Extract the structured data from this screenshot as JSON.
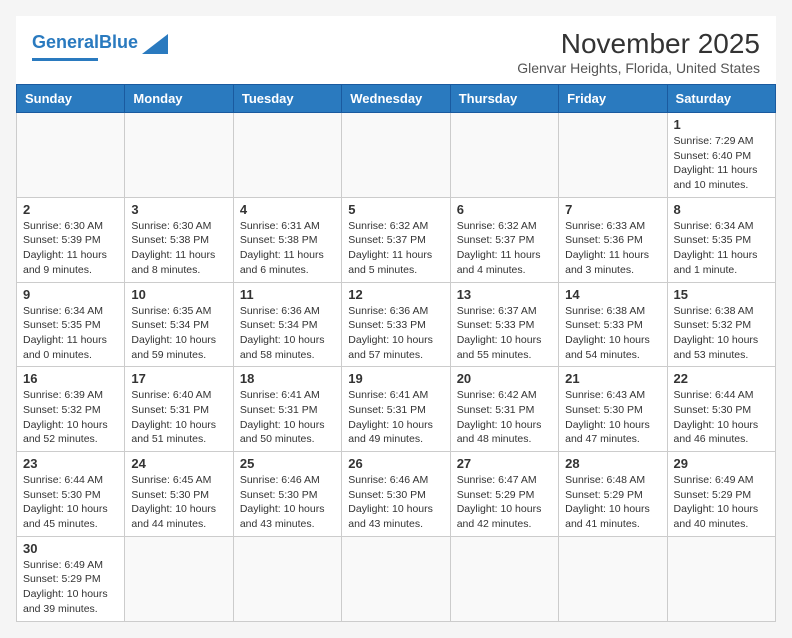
{
  "header": {
    "logo_general": "General",
    "logo_blue": "Blue",
    "month_title": "November 2025",
    "location": "Glenvar Heights, Florida, United States"
  },
  "days_of_week": [
    "Sunday",
    "Monday",
    "Tuesday",
    "Wednesday",
    "Thursday",
    "Friday",
    "Saturday"
  ],
  "weeks": [
    [
      {
        "day": "",
        "info": ""
      },
      {
        "day": "",
        "info": ""
      },
      {
        "day": "",
        "info": ""
      },
      {
        "day": "",
        "info": ""
      },
      {
        "day": "",
        "info": ""
      },
      {
        "day": "",
        "info": ""
      },
      {
        "day": "1",
        "info": "Sunrise: 7:29 AM\nSunset: 6:40 PM\nDaylight: 11 hours and 10 minutes."
      }
    ],
    [
      {
        "day": "2",
        "info": "Sunrise: 6:30 AM\nSunset: 5:39 PM\nDaylight: 11 hours and 9 minutes."
      },
      {
        "day": "3",
        "info": "Sunrise: 6:30 AM\nSunset: 5:38 PM\nDaylight: 11 hours and 8 minutes."
      },
      {
        "day": "4",
        "info": "Sunrise: 6:31 AM\nSunset: 5:38 PM\nDaylight: 11 hours and 6 minutes."
      },
      {
        "day": "5",
        "info": "Sunrise: 6:32 AM\nSunset: 5:37 PM\nDaylight: 11 hours and 5 minutes."
      },
      {
        "day": "6",
        "info": "Sunrise: 6:32 AM\nSunset: 5:37 PM\nDaylight: 11 hours and 4 minutes."
      },
      {
        "day": "7",
        "info": "Sunrise: 6:33 AM\nSunset: 5:36 PM\nDaylight: 11 hours and 3 minutes."
      },
      {
        "day": "8",
        "info": "Sunrise: 6:34 AM\nSunset: 5:35 PM\nDaylight: 11 hours and 1 minute."
      }
    ],
    [
      {
        "day": "9",
        "info": "Sunrise: 6:34 AM\nSunset: 5:35 PM\nDaylight: 11 hours and 0 minutes."
      },
      {
        "day": "10",
        "info": "Sunrise: 6:35 AM\nSunset: 5:34 PM\nDaylight: 10 hours and 59 minutes."
      },
      {
        "day": "11",
        "info": "Sunrise: 6:36 AM\nSunset: 5:34 PM\nDaylight: 10 hours and 58 minutes."
      },
      {
        "day": "12",
        "info": "Sunrise: 6:36 AM\nSunset: 5:33 PM\nDaylight: 10 hours and 57 minutes."
      },
      {
        "day": "13",
        "info": "Sunrise: 6:37 AM\nSunset: 5:33 PM\nDaylight: 10 hours and 55 minutes."
      },
      {
        "day": "14",
        "info": "Sunrise: 6:38 AM\nSunset: 5:33 PM\nDaylight: 10 hours and 54 minutes."
      },
      {
        "day": "15",
        "info": "Sunrise: 6:38 AM\nSunset: 5:32 PM\nDaylight: 10 hours and 53 minutes."
      }
    ],
    [
      {
        "day": "16",
        "info": "Sunrise: 6:39 AM\nSunset: 5:32 PM\nDaylight: 10 hours and 52 minutes."
      },
      {
        "day": "17",
        "info": "Sunrise: 6:40 AM\nSunset: 5:31 PM\nDaylight: 10 hours and 51 minutes."
      },
      {
        "day": "18",
        "info": "Sunrise: 6:41 AM\nSunset: 5:31 PM\nDaylight: 10 hours and 50 minutes."
      },
      {
        "day": "19",
        "info": "Sunrise: 6:41 AM\nSunset: 5:31 PM\nDaylight: 10 hours and 49 minutes."
      },
      {
        "day": "20",
        "info": "Sunrise: 6:42 AM\nSunset: 5:31 PM\nDaylight: 10 hours and 48 minutes."
      },
      {
        "day": "21",
        "info": "Sunrise: 6:43 AM\nSunset: 5:30 PM\nDaylight: 10 hours and 47 minutes."
      },
      {
        "day": "22",
        "info": "Sunrise: 6:44 AM\nSunset: 5:30 PM\nDaylight: 10 hours and 46 minutes."
      }
    ],
    [
      {
        "day": "23",
        "info": "Sunrise: 6:44 AM\nSunset: 5:30 PM\nDaylight: 10 hours and 45 minutes."
      },
      {
        "day": "24",
        "info": "Sunrise: 6:45 AM\nSunset: 5:30 PM\nDaylight: 10 hours and 44 minutes."
      },
      {
        "day": "25",
        "info": "Sunrise: 6:46 AM\nSunset: 5:30 PM\nDaylight: 10 hours and 43 minutes."
      },
      {
        "day": "26",
        "info": "Sunrise: 6:46 AM\nSunset: 5:30 PM\nDaylight: 10 hours and 43 minutes."
      },
      {
        "day": "27",
        "info": "Sunrise: 6:47 AM\nSunset: 5:29 PM\nDaylight: 10 hours and 42 minutes."
      },
      {
        "day": "28",
        "info": "Sunrise: 6:48 AM\nSunset: 5:29 PM\nDaylight: 10 hours and 41 minutes."
      },
      {
        "day": "29",
        "info": "Sunrise: 6:49 AM\nSunset: 5:29 PM\nDaylight: 10 hours and 40 minutes."
      }
    ],
    [
      {
        "day": "30",
        "info": "Sunrise: 6:49 AM\nSunset: 5:29 PM\nDaylight: 10 hours and 39 minutes."
      },
      {
        "day": "",
        "info": ""
      },
      {
        "day": "",
        "info": ""
      },
      {
        "day": "",
        "info": ""
      },
      {
        "day": "",
        "info": ""
      },
      {
        "day": "",
        "info": ""
      },
      {
        "day": "",
        "info": ""
      }
    ]
  ]
}
